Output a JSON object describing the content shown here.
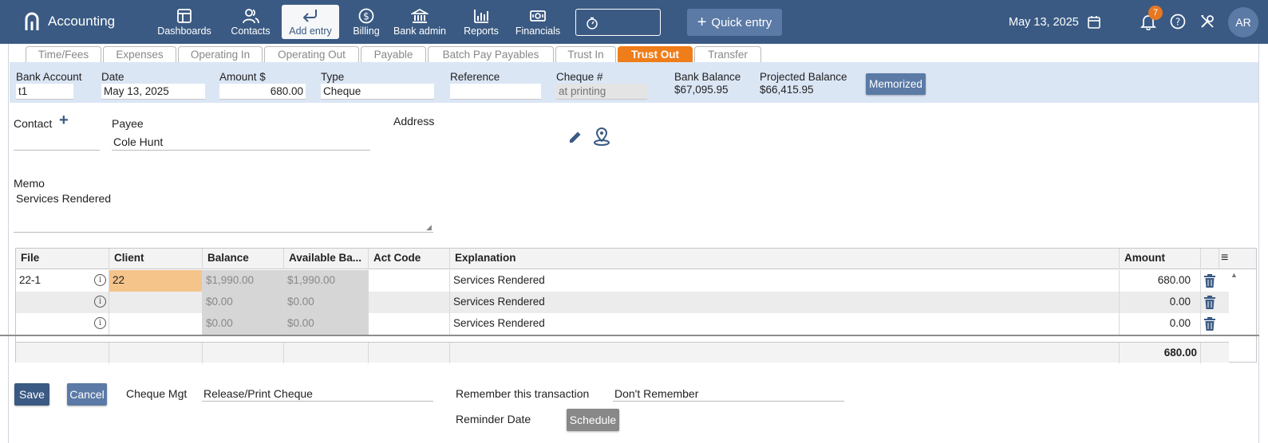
{
  "app": {
    "title": "Accounting"
  },
  "nav": {
    "dashboards": "Dashboards",
    "contacts": "Contacts",
    "add_entry": "Add entry",
    "billing": "Billing",
    "bank_admin": "Bank admin",
    "reports": "Reports",
    "financials": "Financials"
  },
  "quick_entry": "Quick entry",
  "top_date": "May 13, 2025",
  "notifications_count": "7",
  "avatar_initials": "AR",
  "tabs": [
    "Time/Fees",
    "Expenses",
    "Operating In",
    "Operating Out",
    "Payable",
    "Batch Pay Payables",
    "Trust In",
    "Trust Out",
    "Transfer"
  ],
  "active_tab": "Trust Out",
  "header": {
    "bank_account_label": "Bank Account",
    "bank_account_value": "t1",
    "date_label": "Date",
    "date_value": "May 13, 2025",
    "amount_label": "Amount $",
    "amount_value": "680.00",
    "type_label": "Type",
    "type_value": "Cheque",
    "reference_label": "Reference",
    "reference_value": "",
    "cheque_label": "Cheque #",
    "cheque_placeholder": "at printing",
    "bank_balance_label": "Bank Balance",
    "bank_balance_value": "$67,095.95",
    "projected_balance_label": "Projected Balance",
    "projected_balance_value": "$66,415.95",
    "memorized_button": "Memorized"
  },
  "contact": {
    "contact_label": "Contact",
    "payee_label": "Payee",
    "payee_value": "Cole Hunt",
    "address_label": "Address"
  },
  "memo": {
    "label": "Memo",
    "value": "Services Rendered"
  },
  "grid": {
    "columns": [
      "File",
      "Client",
      "Balance",
      "Available Ba...",
      "Act Code",
      "Explanation",
      "Amount"
    ],
    "rows": [
      {
        "file": "22-1",
        "client": "22",
        "balance": "$1,990.00",
        "available": "$1,990.00",
        "act_code": "",
        "explanation": "Services Rendered",
        "amount": "680.00"
      },
      {
        "file": "",
        "client": "",
        "balance": "$0.00",
        "available": "$0.00",
        "act_code": "",
        "explanation": "Services Rendered",
        "amount": "0.00"
      },
      {
        "file": "",
        "client": "",
        "balance": "$0.00",
        "available": "$0.00",
        "act_code": "",
        "explanation": "Services Rendered",
        "amount": "0.00"
      }
    ],
    "total": "680.00"
  },
  "bottom": {
    "save": "Save",
    "cancel": "Cancel",
    "cheque_mgt_label": "Cheque Mgt",
    "cheque_mgt_value": "Release/Print Cheque",
    "remember_label": "Remember this transaction",
    "remember_value": "Don't Remember",
    "reminder_label": "Reminder Date",
    "schedule_button": "Schedule"
  },
  "colors": {
    "topbar": "#3a5a83",
    "accent_orange": "#ef7d19",
    "band": "#dbe6f5",
    "button_blue": "#5b7aa6"
  }
}
